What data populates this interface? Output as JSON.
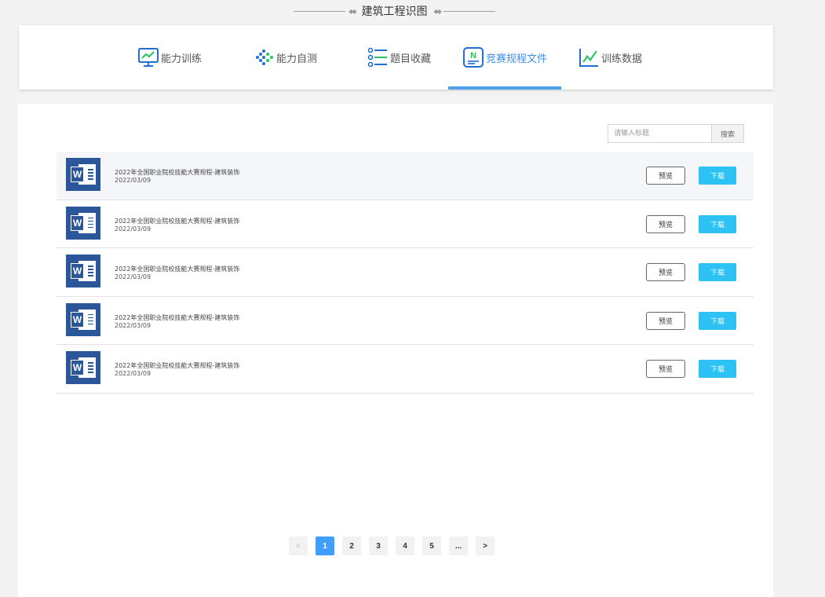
{
  "page": {
    "title": "建筑工程识图"
  },
  "tabs": [
    {
      "label": "能力训练",
      "icon": "monitor-chart-icon",
      "active": false
    },
    {
      "label": "能力自测",
      "icon": "dots-arrow-icon",
      "active": false
    },
    {
      "label": "题目收藏",
      "icon": "list-icon",
      "active": false
    },
    {
      "label": "竞赛规程文件",
      "icon": "document-n-icon",
      "active": true
    },
    {
      "label": "训练数据",
      "icon": "line-chart-icon",
      "active": false
    }
  ],
  "search": {
    "placeholder": "请输入标题",
    "button_label": "搜索"
  },
  "files": [
    {
      "name": "2022年全国职业院校技能大赛规程-建筑装饰",
      "date": "2022/03/09",
      "preview_label": "预览",
      "download_label": "下载",
      "icon": "word-icon"
    },
    {
      "name": "2022年全国职业院校技能大赛规程-建筑装饰",
      "date": "2022/03/09",
      "preview_label": "预览",
      "download_label": "下载",
      "icon": "word-icon"
    },
    {
      "name": "2022年全国职业院校技能大赛规程-建筑装饰",
      "date": "2022/03/09",
      "preview_label": "预览",
      "download_label": "下载",
      "icon": "word-icon"
    },
    {
      "name": "2022年全国职业院校技能大赛规程-建筑装饰",
      "date": "2022/03/09",
      "preview_label": "预览",
      "download_label": "下载",
      "icon": "word-icon"
    },
    {
      "name": "2022年全国职业院校技能大赛规程-建筑装饰",
      "date": "2022/03/09",
      "preview_label": "预览",
      "download_label": "下载",
      "icon": "word-icon"
    }
  ],
  "pagination": {
    "prev": "<",
    "pages": [
      "1",
      "2",
      "3",
      "4",
      "5"
    ],
    "ellipsis": "...",
    "next": ">",
    "current": "1"
  },
  "colors": {
    "accent": "#3d8ee8",
    "download": "#2ec1f3",
    "active_page": "#409eff",
    "word_blue": "#2b579a"
  }
}
